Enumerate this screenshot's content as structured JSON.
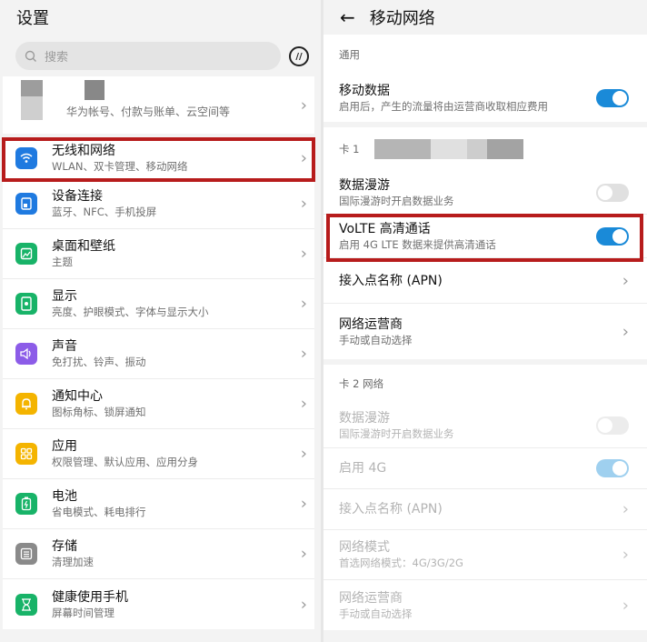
{
  "left": {
    "title": "设置",
    "search_placeholder": "搜索",
    "account_sub": "华为帐号、付款与账单、云空间等",
    "items": [
      {
        "title": "无线和网络",
        "sub": "WLAN、双卡管理、移动网络",
        "icon": "wifi-icon",
        "color": "#1f7ae0"
      },
      {
        "title": "设备连接",
        "sub": "蓝牙、NFC、手机投屏",
        "icon": "device-connect-icon",
        "color": "#1f7ae0"
      },
      {
        "title": "桌面和壁纸",
        "sub": "主题",
        "icon": "wallpaper-icon",
        "color": "#18b368"
      },
      {
        "title": "显示",
        "sub": "亮度、护眼模式、字体与显示大小",
        "icon": "display-icon",
        "color": "#18b368"
      },
      {
        "title": "声音",
        "sub": "免打扰、铃声、振动",
        "icon": "sound-icon",
        "color": "#8c5ce8"
      },
      {
        "title": "通知中心",
        "sub": "图标角标、锁屏通知",
        "icon": "bell-icon",
        "color": "#f4b400"
      },
      {
        "title": "应用",
        "sub": "权限管理、默认应用、应用分身",
        "icon": "apps-icon",
        "color": "#f4b400"
      },
      {
        "title": "电池",
        "sub": "省电模式、耗电排行",
        "icon": "battery-icon",
        "color": "#18b368"
      },
      {
        "title": "存储",
        "sub": "清理加速",
        "icon": "storage-icon",
        "color": "#8a8a8a"
      },
      {
        "title": "健康使用手机",
        "sub": "屏幕时间管理",
        "icon": "hourglass-icon",
        "color": "#18b368"
      }
    ]
  },
  "right": {
    "title": "移动网络",
    "general_header": "通用",
    "mobile_data": {
      "title": "移动数据",
      "sub": "启用后，产生的流量将由运营商收取相应费用",
      "on": true
    },
    "card1_label": "卡 1",
    "card1_items": [
      {
        "title": "数据漫游",
        "sub": "国际漫游时开启数据业务",
        "control": "toggle-off"
      },
      {
        "title": "VoLTE 高清通话",
        "sub": "启用 4G LTE 数据来提供高清通话",
        "control": "toggle-on"
      },
      {
        "title": "接入点名称 (APN)",
        "sub": "",
        "control": "chevron"
      },
      {
        "title": "网络运营商",
        "sub": "手动或自动选择",
        "control": "chevron"
      }
    ],
    "card2_header": "卡 2 网络",
    "card2_items": [
      {
        "title": "数据漫游",
        "sub": "国际漫游时开启数据业务",
        "control": "toggle-off"
      },
      {
        "title": "启用 4G",
        "sub": "",
        "control": "toggle-on"
      },
      {
        "title": "接入点名称 (APN)",
        "sub": "",
        "control": "chevron"
      },
      {
        "title": "网络模式",
        "sub": "首选网络模式：4G/3G/2G",
        "control": "chevron"
      },
      {
        "title": "网络运营商",
        "sub": "手动或自动选择",
        "control": "chevron"
      }
    ]
  },
  "colors": {
    "accent": "#1a8ad8",
    "highlight": "#b71c1c"
  }
}
